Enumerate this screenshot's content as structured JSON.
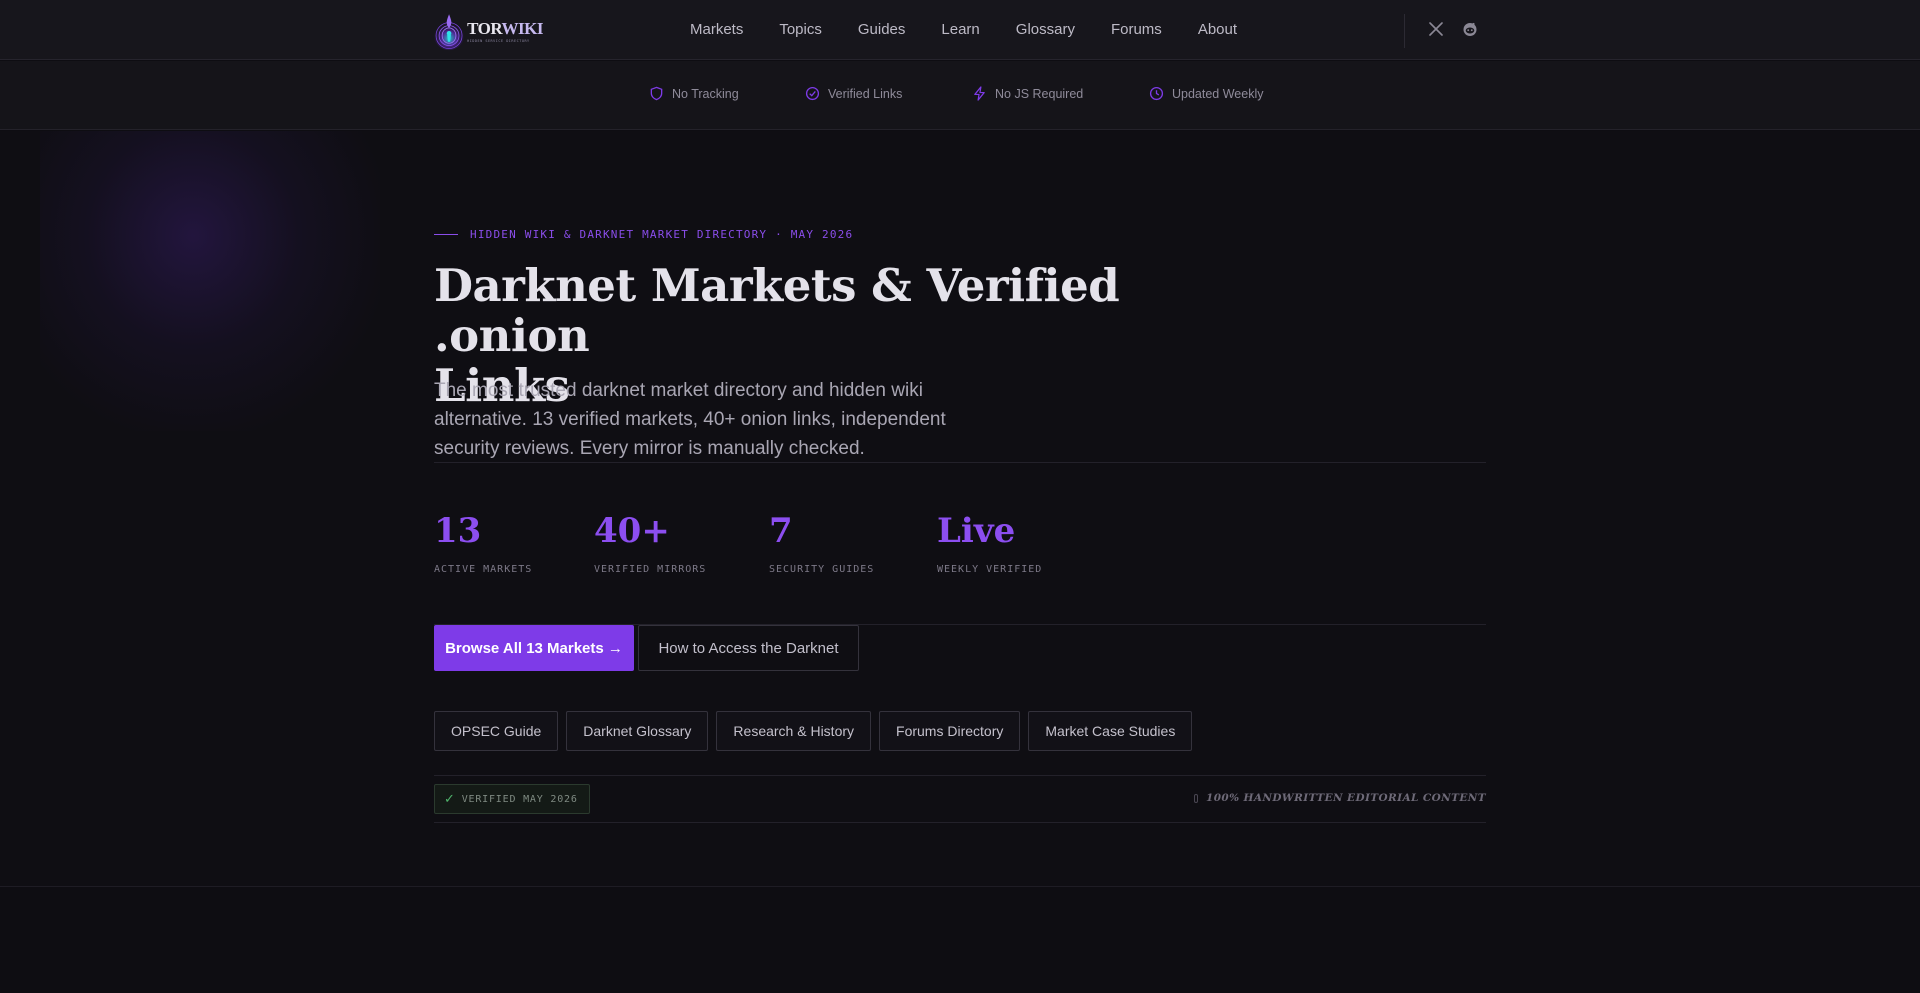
{
  "brand": {
    "logo_word_a": "TOR",
    "logo_word_b": "WIKI",
    "logo_tagline": "HIDDEN SERVICE DIRECTORY"
  },
  "nav": {
    "items": [
      {
        "label": "Markets"
      },
      {
        "label": "Topics"
      },
      {
        "label": "Guides"
      },
      {
        "label": "Learn"
      },
      {
        "label": "Glossary"
      },
      {
        "label": "Forums"
      },
      {
        "label": "About"
      }
    ],
    "social": [
      {
        "icon": "x-twitter-icon"
      },
      {
        "icon": "reddit-icon"
      }
    ]
  },
  "features": [
    {
      "label": "No Tracking",
      "icon": "shield-icon"
    },
    {
      "label": "Verified Links",
      "icon": "check-circle-icon"
    },
    {
      "label": "No JS Required",
      "icon": "lightning-icon"
    },
    {
      "label": "Updated Weekly",
      "icon": "clock-icon"
    }
  ],
  "hero": {
    "eyebrow": "HIDDEN WIKI & DARKNET MARKET DIRECTORY · MAY 2026",
    "headline_line1": "Darknet Markets & Verified .onion",
    "headline_line2": "Links",
    "lede": "The most trusted darknet market directory and hidden wiki alternative. 13 verified markets, 40+ onion links, independent security reviews. Every mirror is manually checked.",
    "stats": [
      {
        "value": "13",
        "label": "ACTIVE MARKETS"
      },
      {
        "value": "40+",
        "label": "VERIFIED MIRRORS"
      },
      {
        "value": "7",
        "label": "SECURITY GUIDES"
      },
      {
        "value": "Live",
        "label": "WEEKLY VERIFIED"
      }
    ],
    "primary_cta": "Browse All 13 Markets →",
    "secondary_cta": "How to Access the Darknet",
    "chips": [
      {
        "label": "OPSEC Guide"
      },
      {
        "label": "Darknet Glossary"
      },
      {
        "label": "Research & History"
      },
      {
        "label": "Forums Directory"
      },
      {
        "label": "Market Case Studies"
      }
    ],
    "verified_badge": "VERIFIED MAY 2026",
    "editorial_note": "100% HANDWRITTEN EDITORIAL CONTENT"
  },
  "colors": {
    "accent": "#7e3be8",
    "stat_accent": "#8c4ef0",
    "background": "#0e0d12",
    "verified_check": "#4fb36b"
  }
}
